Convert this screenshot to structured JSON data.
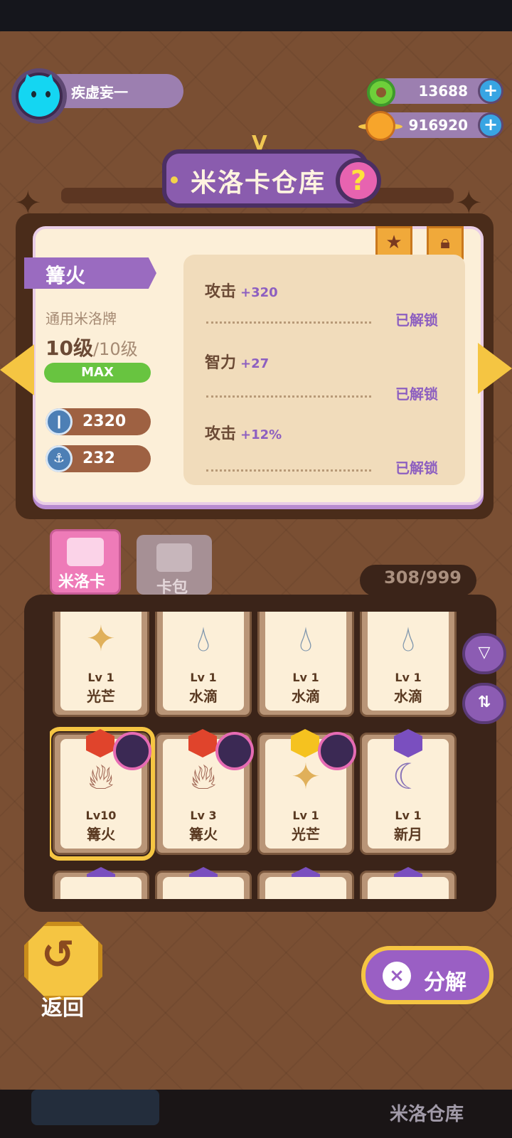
{
  "player": {
    "name": "疾虚妄一"
  },
  "currencies": [
    {
      "icon": "green-donut-icon",
      "value": "13688"
    },
    {
      "icon": "planet-coin-icon",
      "value": "916920"
    }
  ],
  "header": {
    "title": "米洛卡仓库",
    "help": "?",
    "pin": "V"
  },
  "detail": {
    "name": "篝火",
    "type": "通用米洛牌",
    "level": "10级",
    "level_max": "/10级",
    "max_badge": "MAX",
    "stats": [
      {
        "icon": "hp-icon",
        "value": "2320"
      },
      {
        "icon": "defense-icon",
        "value": "232"
      }
    ],
    "attributes": [
      {
        "name": "攻击",
        "value": "+320",
        "status": "已解锁"
      },
      {
        "name": "智力",
        "value": "+27",
        "status": "已解锁"
      },
      {
        "name": "攻击",
        "value": "+12%",
        "status": "已解锁"
      }
    ]
  },
  "tabs": {
    "milo_card": "米洛卡",
    "card_pack": "卡包"
  },
  "capacity": {
    "current": "308",
    "max": "/999"
  },
  "cards": [
    {
      "lv": "Lv 1",
      "name": "光芒",
      "icon": "shooting-star-icon",
      "rarity": "orange"
    },
    {
      "lv": "Lv 1",
      "name": "水滴",
      "icon": "water-drop-icon",
      "rarity": "blue"
    },
    {
      "lv": "Lv 1",
      "name": "水滴",
      "icon": "water-drop-icon",
      "rarity": "blue"
    },
    {
      "lv": "Lv 1",
      "name": "水滴",
      "icon": "water-drop-icon",
      "rarity": "blue"
    },
    {
      "lv": "Lv10",
      "name": "篝火",
      "icon": "campfire-icon",
      "rarity": "red",
      "selected": true
    },
    {
      "lv": "Lv 3",
      "name": "篝火",
      "icon": "campfire-icon",
      "rarity": "red"
    },
    {
      "lv": "Lv 1",
      "name": "光芒",
      "icon": "shooting-star-icon",
      "rarity": "yellow"
    },
    {
      "lv": "Lv 1",
      "name": "新月",
      "icon": "moon-cloud-icon",
      "rarity": "purple"
    }
  ],
  "buttons": {
    "back": "返回",
    "decompose": "分解",
    "decompose_icon": "×"
  },
  "footer": {
    "ghost_label": "米洛仓库"
  },
  "colors": {
    "accent_purple": "#9a5fc4",
    "gold": "#f5c542",
    "max_green": "#68c440"
  }
}
